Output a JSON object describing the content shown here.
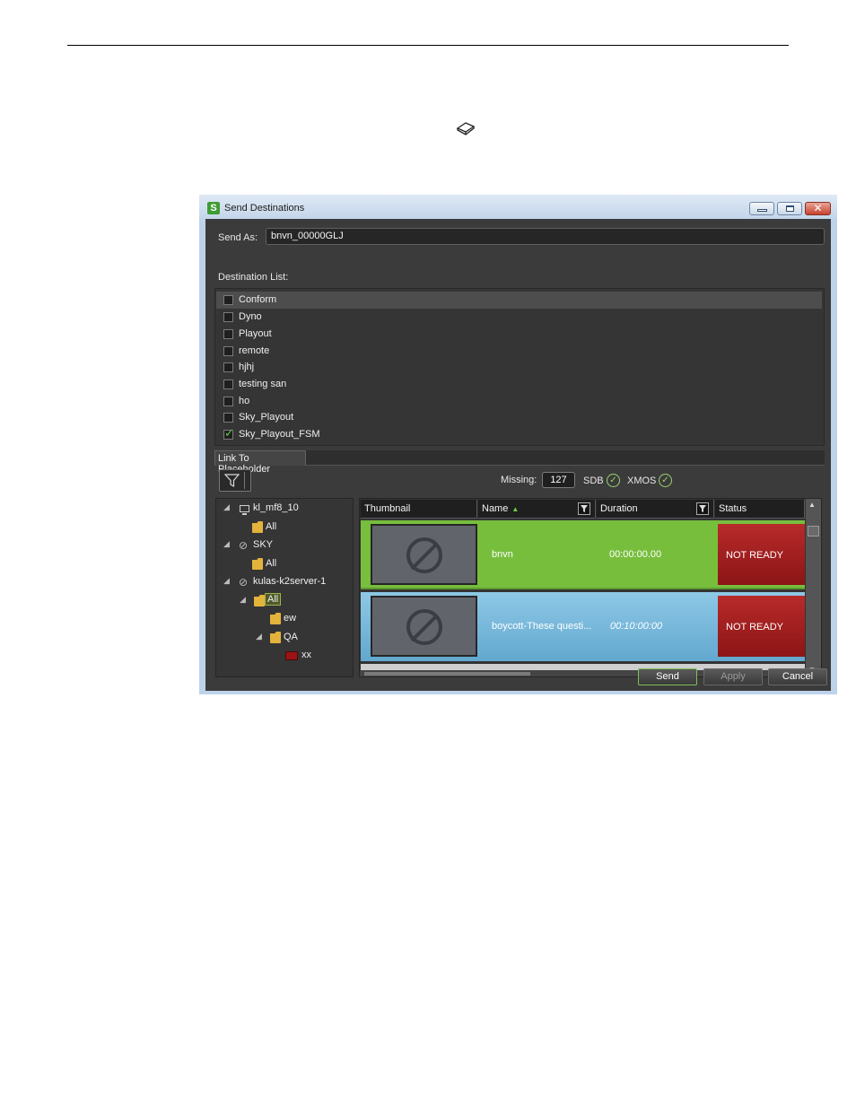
{
  "window": {
    "title": "Send Destinations",
    "close_glyph": "✕"
  },
  "send_as": {
    "label": "Send As:",
    "value": "bnvn_00000GLJ"
  },
  "destination_list": {
    "label": "Destination List:",
    "items": [
      {
        "label": "Conform",
        "checked": false
      },
      {
        "label": "Dyno",
        "checked": false
      },
      {
        "label": "Playout",
        "checked": false
      },
      {
        "label": "remote",
        "checked": false
      },
      {
        "label": "hjhj",
        "checked": false
      },
      {
        "label": "testing san",
        "checked": false
      },
      {
        "label": "ho",
        "checked": false
      },
      {
        "label": "Sky_Playout",
        "checked": false
      },
      {
        "label": "Sky_Playout_FSM",
        "checked": true
      }
    ]
  },
  "tabs": {
    "link_placeholder": "Link To Placeholder"
  },
  "status_bar": {
    "missing_label": "Missing:",
    "missing_value": "127",
    "sdb_label": "SDB",
    "xmos_label": "XMOS",
    "ok_glyph": "✓"
  },
  "tree": {
    "expand_glyph": "◢",
    "nodes": [
      {
        "label": "kl_mf8_10"
      },
      {
        "label": "All"
      },
      {
        "label": "SKY"
      },
      {
        "label": "All"
      },
      {
        "label": "kulas-k2server-1"
      },
      {
        "label": "All"
      },
      {
        "label": "ew"
      },
      {
        "label": "QA"
      },
      {
        "label": "xx"
      }
    ],
    "disc_glyph": "⊘"
  },
  "grid": {
    "columns": {
      "thumbnail": "Thumbnail",
      "name": "Name",
      "duration": "Duration",
      "status": "Status"
    },
    "sort_glyph": "▲",
    "rows": [
      {
        "name": "bnvn",
        "duration": "00:00:00.00",
        "status": "NOT READY"
      },
      {
        "name": "boycott-These questi...",
        "duration": "00:10:00:00",
        "status": "NOT READY"
      }
    ],
    "scroll_up": "▲",
    "scroll_down": "▼"
  },
  "buttons": {
    "send": "Send",
    "apply": "Apply",
    "cancel": "Cancel"
  },
  "colors": {
    "row_selected": "#77be3d",
    "row_alt": "#62a8cf",
    "status_not_ready": "#b82a2a",
    "check_mark": "#58d23a"
  }
}
